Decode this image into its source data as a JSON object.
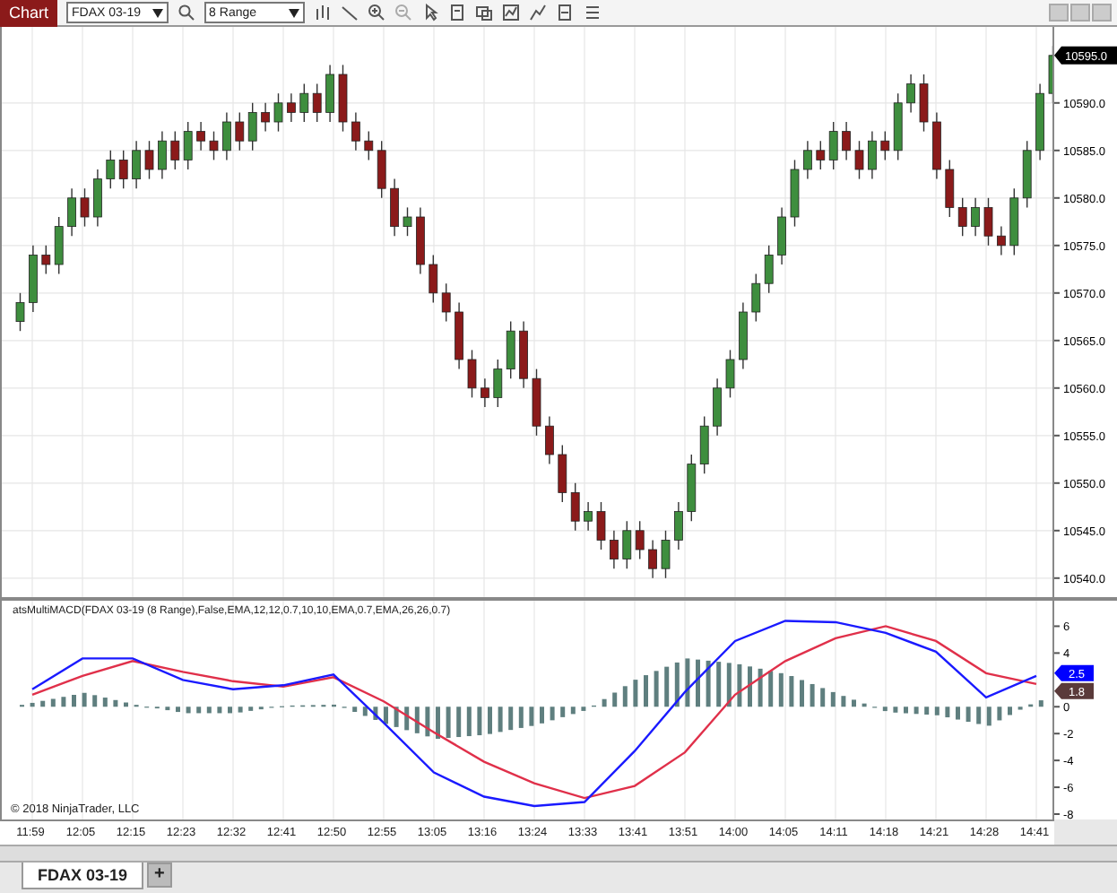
{
  "toolbar": {
    "app_label": "Chart",
    "instrument": "FDAX 03-19",
    "period": "8 Range"
  },
  "price_panel": {
    "last_price": "10595.0",
    "chart_data": {
      "type": "candlestick",
      "grid": true,
      "ylim": [
        10538,
        10598
      ],
      "yticks": [
        {
          "value": 10590,
          "label": "10590.0"
        },
        {
          "value": 10585,
          "label": "10585.0"
        },
        {
          "value": 10580,
          "label": "10580.0"
        },
        {
          "value": 10575,
          "label": "10575.0"
        },
        {
          "value": 10570,
          "label": "10570.0"
        },
        {
          "value": 10565,
          "label": "10565.0"
        },
        {
          "value": 10560,
          "label": "10560.0"
        },
        {
          "value": 10555,
          "label": "10555.0"
        },
        {
          "value": 10550,
          "label": "10550.0"
        },
        {
          "value": 10545,
          "label": "10545.0"
        },
        {
          "value": 10540,
          "label": "10540.0"
        }
      ],
      "ohlc": [
        [
          10567,
          10570,
          10566,
          10569
        ],
        [
          10569,
          10575,
          10568,
          10574
        ],
        [
          10574,
          10575,
          10572,
          10573
        ],
        [
          10573,
          10578,
          10572,
          10577
        ],
        [
          10577,
          10581,
          10576,
          10580
        ],
        [
          10580,
          10581,
          10577,
          10578
        ],
        [
          10578,
          10583,
          10577,
          10582
        ],
        [
          10582,
          10585,
          10581,
          10584
        ],
        [
          10584,
          10585,
          10581,
          10582
        ],
        [
          10582,
          10586,
          10581,
          10585
        ],
        [
          10585,
          10586,
          10582,
          10583
        ],
        [
          10583,
          10587,
          10582,
          10586
        ],
        [
          10586,
          10587,
          10583,
          10584
        ],
        [
          10584,
          10588,
          10583,
          10587
        ],
        [
          10587,
          10588,
          10585,
          10586
        ],
        [
          10586,
          10587,
          10584,
          10585
        ],
        [
          10585,
          10589,
          10584,
          10588
        ],
        [
          10588,
          10589,
          10585,
          10586
        ],
        [
          10586,
          10590,
          10585,
          10589
        ],
        [
          10589,
          10590,
          10587,
          10588
        ],
        [
          10588,
          10591,
          10587,
          10590
        ],
        [
          10590,
          10591,
          10588,
          10589
        ],
        [
          10589,
          10592,
          10588,
          10591
        ],
        [
          10591,
          10592,
          10588,
          10589
        ],
        [
          10589,
          10594,
          10588,
          10593
        ],
        [
          10593,
          10594,
          10587,
          10588
        ],
        [
          10588,
          10589,
          10585,
          10586
        ],
        [
          10586,
          10587,
          10584,
          10585
        ],
        [
          10585,
          10586,
          10580,
          10581
        ],
        [
          10581,
          10582,
          10576,
          10577
        ],
        [
          10577,
          10579,
          10576,
          10578
        ],
        [
          10578,
          10579,
          10572,
          10573
        ],
        [
          10573,
          10574,
          10569,
          10570
        ],
        [
          10570,
          10571,
          10567,
          10568
        ],
        [
          10568,
          10569,
          10562,
          10563
        ],
        [
          10563,
          10564,
          10559,
          10560
        ],
        [
          10560,
          10561,
          10558,
          10559
        ],
        [
          10559,
          10563,
          10558,
          10562
        ],
        [
          10562,
          10567,
          10561,
          10566
        ],
        [
          10566,
          10567,
          10560,
          10561
        ],
        [
          10561,
          10562,
          10555,
          10556
        ],
        [
          10556,
          10557,
          10552,
          10553
        ],
        [
          10553,
          10554,
          10548,
          10549
        ],
        [
          10549,
          10550,
          10545,
          10546
        ],
        [
          10546,
          10548,
          10545,
          10547
        ],
        [
          10547,
          10548,
          10543,
          10544
        ],
        [
          10544,
          10545,
          10541,
          10542
        ],
        [
          10542,
          10546,
          10541,
          10545
        ],
        [
          10545,
          10546,
          10542,
          10543
        ],
        [
          10543,
          10544,
          10540,
          10541
        ],
        [
          10541,
          10545,
          10540,
          10544
        ],
        [
          10544,
          10548,
          10543,
          10547
        ],
        [
          10547,
          10553,
          10546,
          10552
        ],
        [
          10552,
          10557,
          10551,
          10556
        ],
        [
          10556,
          10561,
          10555,
          10560
        ],
        [
          10560,
          10564,
          10559,
          10563
        ],
        [
          10563,
          10569,
          10562,
          10568
        ],
        [
          10568,
          10572,
          10567,
          10571
        ],
        [
          10571,
          10575,
          10570,
          10574
        ],
        [
          10574,
          10579,
          10573,
          10578
        ],
        [
          10578,
          10584,
          10577,
          10583
        ],
        [
          10583,
          10586,
          10582,
          10585
        ],
        [
          10585,
          10586,
          10583,
          10584
        ],
        [
          10584,
          10588,
          10583,
          10587
        ],
        [
          10587,
          10588,
          10584,
          10585
        ],
        [
          10585,
          10586,
          10582,
          10583
        ],
        [
          10583,
          10587,
          10582,
          10586
        ],
        [
          10586,
          10587,
          10584,
          10585
        ],
        [
          10585,
          10591,
          10584,
          10590
        ],
        [
          10590,
          10593,
          10589,
          10592
        ],
        [
          10592,
          10593,
          10587,
          10588
        ],
        [
          10588,
          10589,
          10582,
          10583
        ],
        [
          10583,
          10584,
          10578,
          10579
        ],
        [
          10579,
          10580,
          10576,
          10577
        ],
        [
          10577,
          10580,
          10576,
          10579
        ],
        [
          10579,
          10580,
          10575,
          10576
        ],
        [
          10576,
          10577,
          10574,
          10575
        ],
        [
          10575,
          10581,
          10574,
          10580
        ],
        [
          10580,
          10586,
          10579,
          10585
        ],
        [
          10585,
          10592,
          10584,
          10591
        ],
        [
          10591,
          10596,
          10590,
          10595
        ]
      ]
    }
  },
  "indicator_panel": {
    "label": "atsMultiMACD(FDAX 03-19 (8 Range),False,EMA,12,12,0.7,10,10,EMA,0.7,EMA,26,26,0.7)",
    "badges": [
      {
        "text": "2.5",
        "color": "#0000ff"
      },
      {
        "text": "1.8",
        "color": "#5a3a3a"
      }
    ],
    "copyright": "© 2018 NinjaTrader, LLC",
    "chart_data": {
      "type": "line",
      "categories": [
        "11:59",
        "12:05",
        "12:15",
        "12:23",
        "12:32",
        "12:41",
        "12:50",
        "12:55",
        "13:05",
        "13:16",
        "13:24",
        "13:33",
        "13:41",
        "13:51",
        "14:00",
        "14:05",
        "14:11",
        "14:18",
        "14:21",
        "14:28",
        "14:41"
      ],
      "grid": true,
      "ylim": [
        -8.4,
        7.9
      ],
      "yticks": [
        6,
        4,
        0,
        -2,
        -4,
        -6,
        -8
      ],
      "series": [
        {
          "color": "#1a1aff",
          "values": [
            1.3,
            3.6,
            3.6,
            2.0,
            1.3,
            1.6,
            2.4,
            -1.2,
            -4.9,
            -6.7,
            -7.4,
            -7.1,
            -3.3,
            1.1,
            4.9,
            6.4,
            6.3,
            5.5,
            4.1,
            0.7,
            2.3
          ]
        },
        {
          "color": "#e0304a",
          "values": [
            0.9,
            2.3,
            3.4,
            2.6,
            1.9,
            1.5,
            2.2,
            0.4,
            -1.9,
            -4.1,
            -5.7,
            -6.8,
            -5.9,
            -3.4,
            0.9,
            3.4,
            5.1,
            6.0,
            4.9,
            2.5,
            1.7
          ]
        }
      ]
    }
  },
  "tabs": [
    {
      "label": "FDAX 03-19",
      "selected": true
    }
  ],
  "add_tab": "+"
}
